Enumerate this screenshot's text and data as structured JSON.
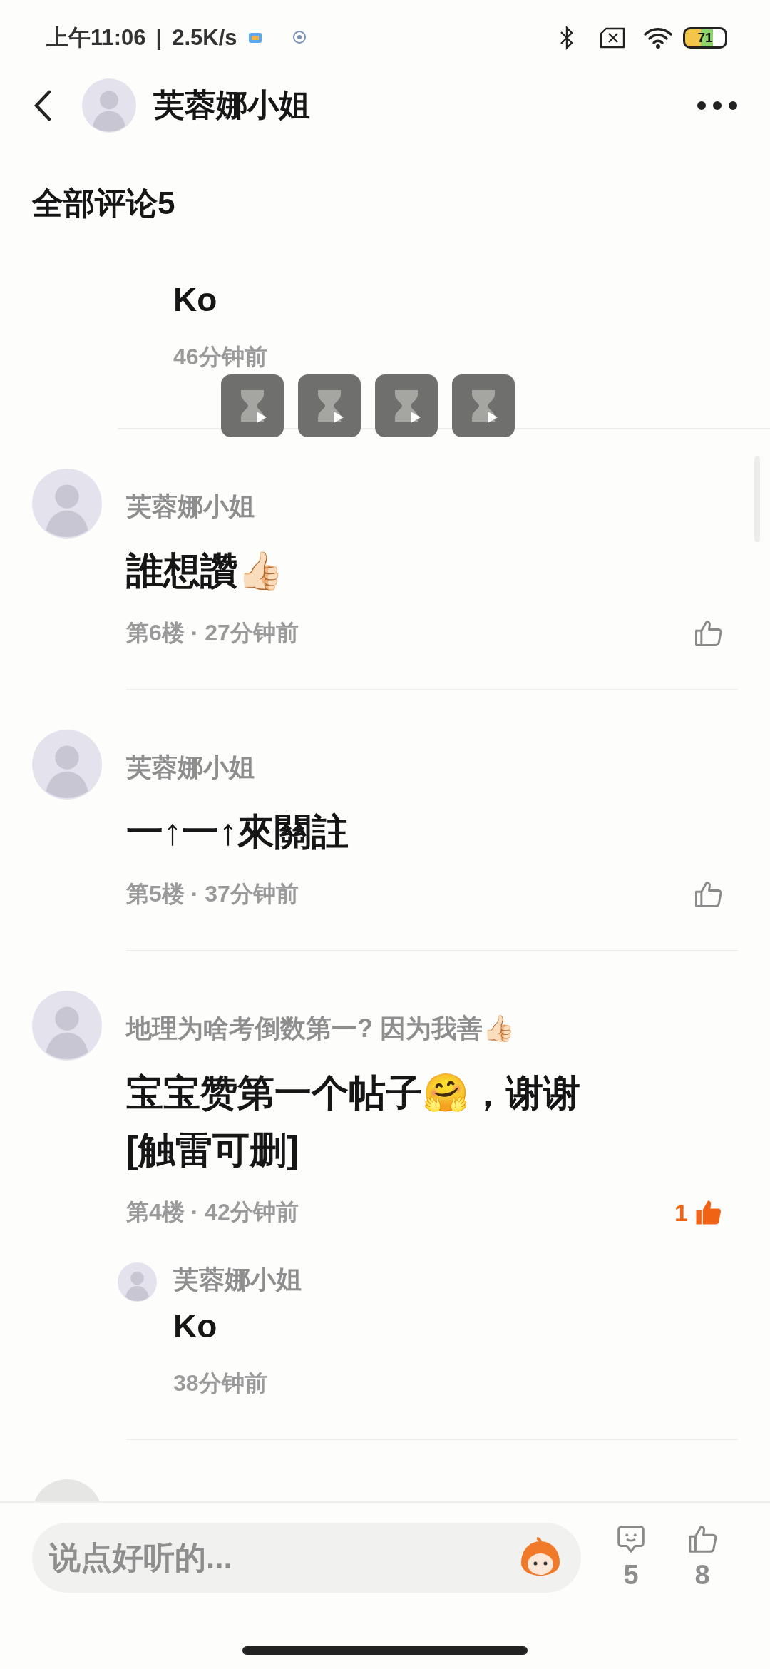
{
  "status_bar": {
    "time": "上午11:06",
    "separator": "|",
    "speed": "2.5K/s",
    "battery": "71"
  },
  "header": {
    "title": "芙蓉娜小姐"
  },
  "section_title": "全部评论5",
  "top_reply": {
    "text": "Ko",
    "time": "46分钟前"
  },
  "comments": [
    {
      "name": "芙蓉娜小姐",
      "text": "誰想讚👍🏻",
      "floor": "第6楼 · 27分钟前",
      "liked": false
    },
    {
      "name": "芙蓉娜小姐",
      "text": "一↑一↑來關註",
      "floor": "第5楼 · 37分钟前",
      "liked": false
    },
    {
      "name": "地理为啥考倒数第一? 因为我善👍🏻",
      "text": "宝宝赞第一个帖子🤗，谢谢 [触雷可删]",
      "floor": "第4楼 · 42分钟前",
      "liked": true,
      "likes": "1",
      "replies": [
        {
          "name": "芙蓉娜小姐",
          "text": "Ko",
          "time": "38分钟前"
        }
      ]
    }
  ],
  "bottom_bar": {
    "placeholder": "说点好听的...",
    "comment_count": "5",
    "like_count": "8"
  }
}
